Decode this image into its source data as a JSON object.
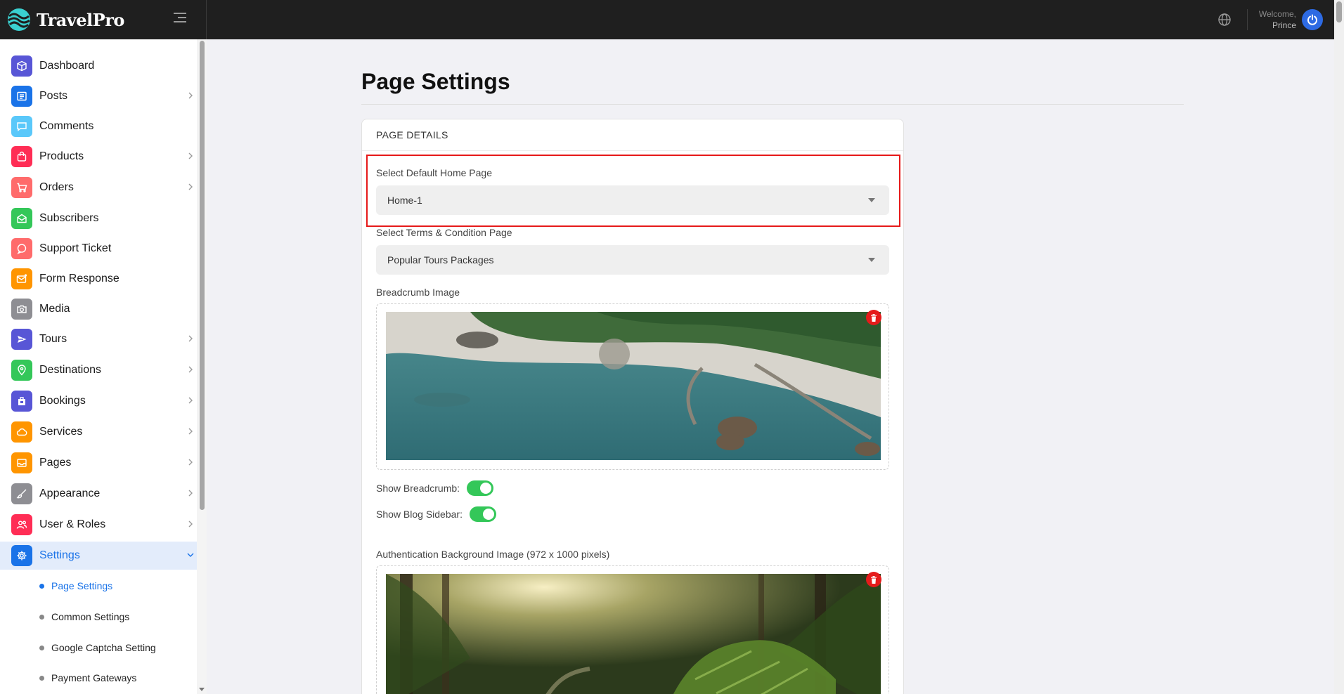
{
  "brand": {
    "name": "TravelPro"
  },
  "header": {
    "welcome_label": "Welcome,",
    "user_name": "Prince"
  },
  "sidebar": {
    "items": [
      {
        "label": "Dashboard",
        "icon": "cube-icon",
        "color": "#5856d6"
      },
      {
        "label": "Posts",
        "icon": "newspaper-icon",
        "color": "#1a73e8"
      },
      {
        "label": "Comments",
        "icon": "chat-bubble-icon",
        "color": "#5ac8fa"
      },
      {
        "label": "Products",
        "icon": "shopping-bag-icon",
        "color": "#ff2d55"
      },
      {
        "label": "Orders",
        "icon": "cart-icon",
        "color": "#ff6b6b"
      },
      {
        "label": "Subscribers",
        "icon": "envelope-open-icon",
        "color": "#34c759"
      },
      {
        "label": "Support Ticket",
        "icon": "support-chat-icon",
        "color": "#ff6b6b"
      },
      {
        "label": "Form Response",
        "icon": "mail-notification-icon",
        "color": "#ff9500"
      },
      {
        "label": "Media",
        "icon": "camera-icon",
        "color": "#8e8e93"
      },
      {
        "label": "Tours",
        "icon": "plane-icon",
        "color": "#5856d6"
      },
      {
        "label": "Destinations",
        "icon": "map-pin-icon",
        "color": "#34c759"
      },
      {
        "label": "Bookings",
        "icon": "booking-bag-icon",
        "color": "#5856d6"
      },
      {
        "label": "Services",
        "icon": "cloud-icon",
        "color": "#ff9500"
      },
      {
        "label": "Pages",
        "icon": "tray-icon",
        "color": "#ff9500"
      },
      {
        "label": "Appearance",
        "icon": "brush-icon",
        "color": "#8e8e93"
      },
      {
        "label": "User & Roles",
        "icon": "users-icon",
        "color": "#ff2d55"
      },
      {
        "label": "Settings",
        "icon": "gear-icon",
        "color": "#1a73e8"
      }
    ],
    "settings_subitems": [
      {
        "label": "Page Settings"
      },
      {
        "label": "Common Settings"
      },
      {
        "label": "Google Captcha Setting"
      },
      {
        "label": "Payment Gateways"
      }
    ]
  },
  "main": {
    "title": "Page Settings",
    "card_title": "PAGE DETAILS",
    "home_page": {
      "label": "Select Default Home Page",
      "value": "Home-1"
    },
    "terms_page": {
      "label": "Select Terms & Condition Page",
      "value": "Popular Tours Packages"
    },
    "breadcrumb_image": {
      "label": "Breadcrumb Image"
    },
    "show_breadcrumb": {
      "label": "Show Breadcrumb:",
      "on": true
    },
    "show_blog_sidebar": {
      "label": "Show Blog Sidebar:",
      "on": true
    },
    "auth_bg_image": {
      "label": "Authentication Background Image (972 x 1000 pixels)"
    }
  },
  "colors": {
    "accent": "#1a73e8",
    "highlight": "#e61919",
    "toggle_on": "#34c759",
    "danger": "#e51b1b",
    "topbar": "#1f1f1f"
  }
}
